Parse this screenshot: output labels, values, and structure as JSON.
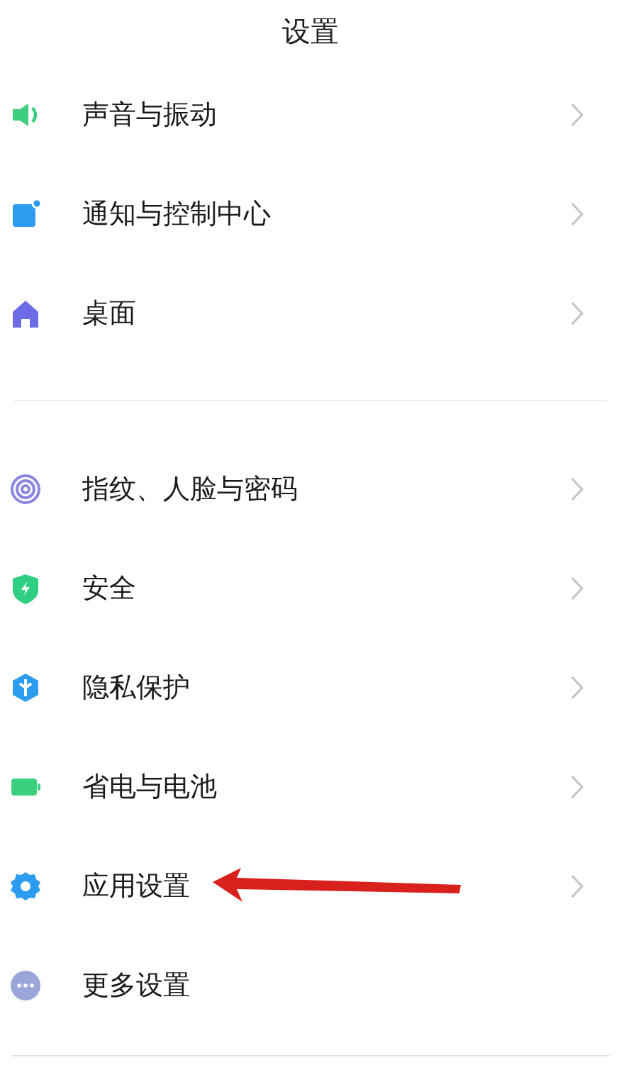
{
  "title": "设置",
  "groups": [
    {
      "items": [
        {
          "label": "声音与振动",
          "kind": "sound",
          "color": "#3ecf7e",
          "chevron": true,
          "pointer_arrow": false
        },
        {
          "label": "通知与控制中心",
          "kind": "notification",
          "color": "#2c9cf0",
          "chevron": true,
          "pointer_arrow": false
        },
        {
          "label": "桌面",
          "kind": "home",
          "color": "#6c6ce6",
          "chevron": true,
          "pointer_arrow": false
        }
      ]
    },
    {
      "items": [
        {
          "label": "指纹、人脸与密码",
          "kind": "fingerprint",
          "color": "#8b86e0",
          "chevron": true,
          "pointer_arrow": false
        },
        {
          "label": "安全",
          "kind": "shield",
          "color": "#2ecf80",
          "chevron": true,
          "pointer_arrow": false
        },
        {
          "label": "隐私保护",
          "kind": "privacy",
          "color": "#2c9cf0",
          "chevron": true,
          "pointer_arrow": false
        },
        {
          "label": "省电与电池",
          "kind": "battery",
          "color": "#3ccf7e",
          "chevron": true,
          "pointer_arrow": false
        },
        {
          "label": "应用设置",
          "kind": "gear",
          "color": "#2c9cf0",
          "chevron": true,
          "pointer_arrow": true
        },
        {
          "label": "更多设置",
          "kind": "more",
          "color": "#9aa6da",
          "chevron": false,
          "pointer_arrow": false
        }
      ]
    }
  ]
}
